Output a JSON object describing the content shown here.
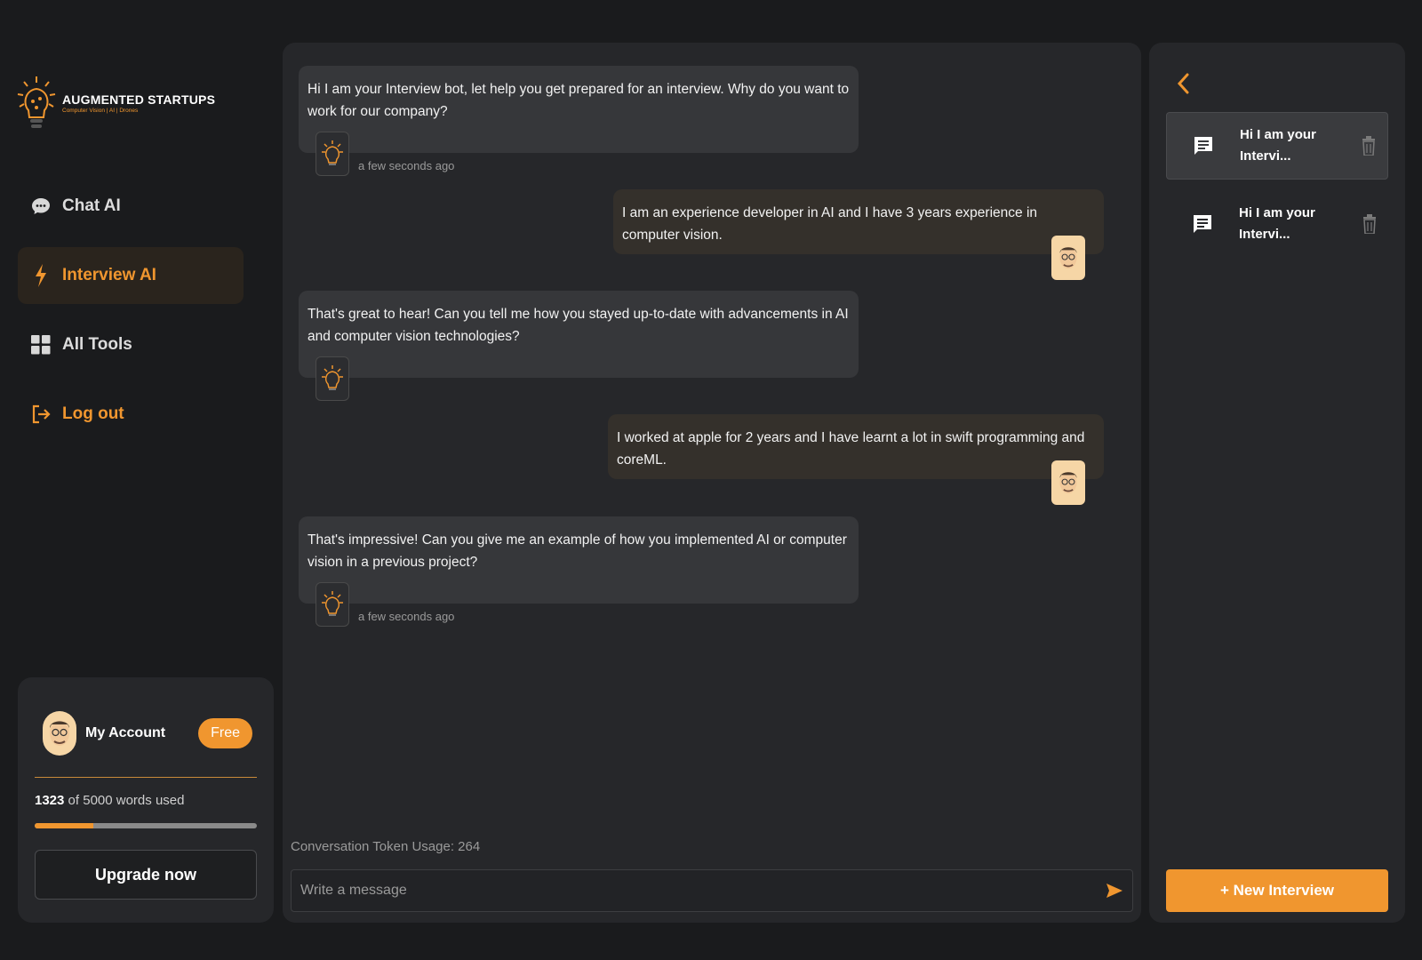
{
  "brand": {
    "name": "AUGMENTED STARTUPS",
    "tagline": "Computer Vision | AI | Drones",
    "accent": "#f0962f"
  },
  "nav": {
    "chat_ai": "Chat AI",
    "interview_ai": "Interview AI",
    "all_tools": "All Tools",
    "log_out": "Log out"
  },
  "account": {
    "label": "My Account",
    "plan": "Free",
    "words_used": "1323",
    "words_rest": "of 5000 words used",
    "usage_fraction": 0.2646,
    "upgrade_label": "Upgrade now"
  },
  "chat": {
    "messages": [
      {
        "role": "bot",
        "text": "Hi I am your Interview bot, let help you get prepared for an interview. Why do you want to work for our company?",
        "time": "a few seconds ago"
      },
      {
        "role": "user",
        "text": "I am an experience developer in AI and I have 3 years experience in computer vision."
      },
      {
        "role": "bot",
        "text": "That's great to hear! Can you tell me how you stayed up-to-date with advancements in AI and computer vision technologies?"
      },
      {
        "role": "user",
        "text": "I worked at apple for 2 years and I have learnt a lot in swift programming and coreML."
      },
      {
        "role": "bot",
        "text": "That's impressive! Can you give me an example of how you implemented AI or computer vision in a previous project?",
        "time": "a few seconds ago"
      }
    ],
    "token_usage": "Conversation Token Usage: 264",
    "input_placeholder": "Write a message"
  },
  "history": {
    "items": [
      {
        "title": "Hi I am your Intervi..."
      },
      {
        "title": "Hi I am your Intervi..."
      }
    ],
    "new_button": "+ New Interview"
  }
}
